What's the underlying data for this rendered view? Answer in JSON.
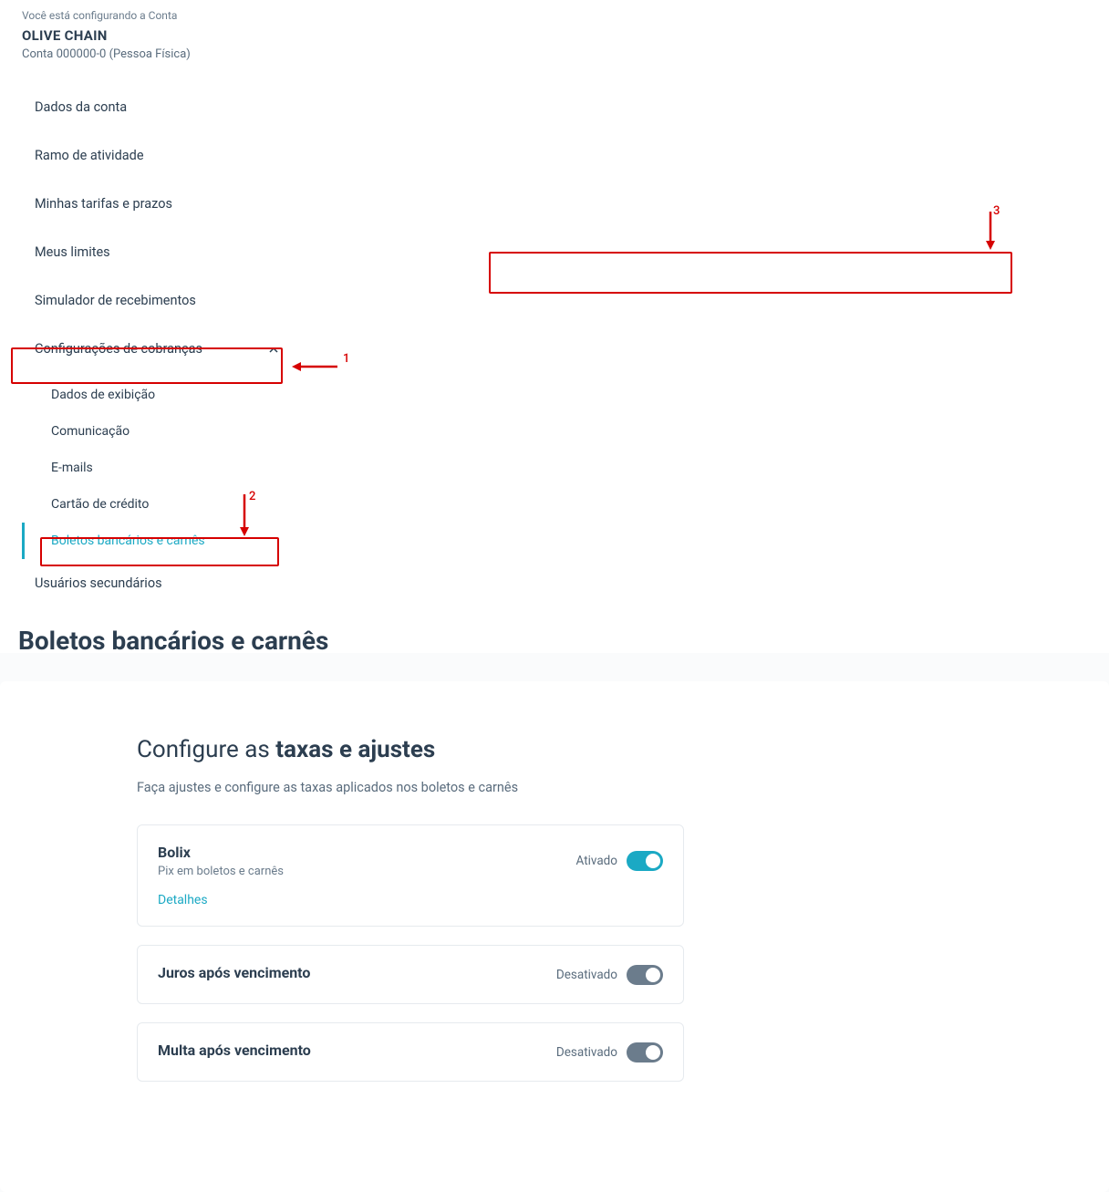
{
  "sidebar": {
    "config_label": "Você está configurando a Conta",
    "account_name": "OLIVE CHAIN",
    "account_info": "Conta 000000-0 (Pessoa Física)",
    "items": [
      {
        "label": "Dados da conta"
      },
      {
        "label": "Ramo de atividade"
      },
      {
        "label": "Minhas tarifas e prazos"
      },
      {
        "label": "Meus limites"
      },
      {
        "label": "Simulador de recebimentos"
      },
      {
        "label": "Configurações de cobranças",
        "expanded": true
      },
      {
        "label": "Usuários secundários"
      }
    ],
    "sub_items": [
      {
        "label": "Dados de exibição"
      },
      {
        "label": "Comunicação"
      },
      {
        "label": "E-mails"
      },
      {
        "label": "Cartão de crédito"
      },
      {
        "label": "Boletos bancários e carnês",
        "active": true
      }
    ]
  },
  "main": {
    "page_title": "Boletos bancários e carnês",
    "section_title_pre": "Configure as ",
    "section_title_bold": "taxas e ajustes",
    "section_desc": "Faça ajustes e configure as taxas aplicados nos boletos e carnês",
    "settings": [
      {
        "name": "Bolix",
        "sub": "Pix em boletos e carnês",
        "state_label": "Ativado",
        "on": true,
        "details": "Detalhes"
      },
      {
        "name": "Juros após vencimento",
        "sub": "",
        "state_label": "Desativado",
        "on": false
      },
      {
        "name": "Multa após vencimento",
        "sub": "",
        "state_label": "Desativado",
        "on": false
      }
    ]
  },
  "annotations": {
    "n1": "1",
    "n2": "2",
    "n3": "3"
  }
}
